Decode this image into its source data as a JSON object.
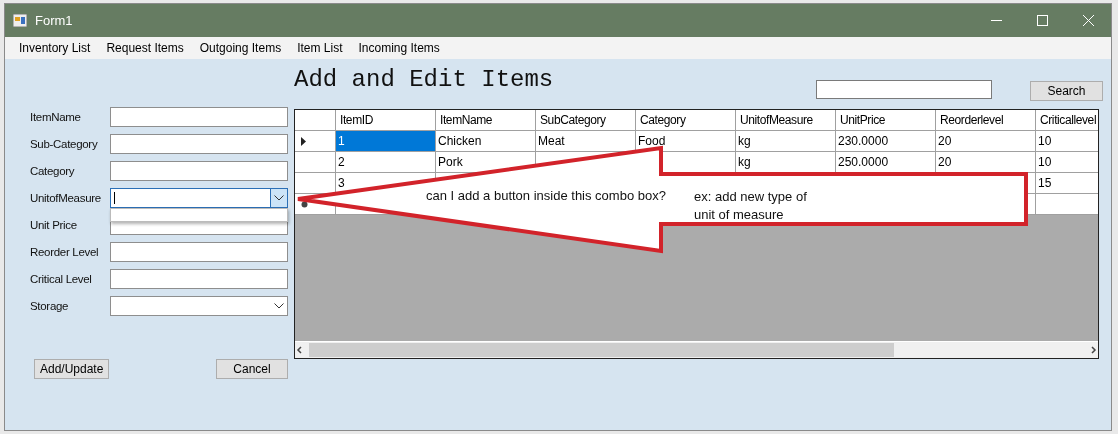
{
  "window": {
    "title": "Form1"
  },
  "menu": [
    "Inventory List",
    "Request Items",
    "Outgoing Items",
    "Item List",
    "Incoming Items"
  ],
  "heading": "Add and Edit Items",
  "form": {
    "fields": [
      {
        "label": "ItemName",
        "kind": "text",
        "focused": false
      },
      {
        "label": "Sub-Category",
        "kind": "text",
        "focused": false
      },
      {
        "label": "Category",
        "kind": "text",
        "focused": false
      },
      {
        "label": "UnitofMeasure",
        "kind": "combo",
        "focused": true,
        "open": true
      },
      {
        "label": "Unit Price",
        "kind": "text",
        "focused": false
      },
      {
        "label": "Reorder Level",
        "kind": "text",
        "focused": false
      },
      {
        "label": "Critical Level",
        "kind": "text",
        "focused": false
      },
      {
        "label": "Storage",
        "kind": "combo",
        "focused": false,
        "open": false
      }
    ],
    "buttons": [
      "Add/Update",
      "Cancel"
    ]
  },
  "search": {
    "button": "Search"
  },
  "grid": {
    "columns": [
      "ItemID",
      "ItemName",
      "SubCategory",
      "Category",
      "UnitofMeasure",
      "UnitPrice",
      "Reorderlevel",
      "Criticallevel"
    ],
    "rows": [
      {
        "kind": "data",
        "selected": true,
        "cells": [
          "1",
          "Chicken",
          "Meat",
          "Food",
          "kg",
          "230.0000",
          "20",
          "10"
        ]
      },
      {
        "kind": "data",
        "selected": false,
        "cells": [
          "2",
          "Pork",
          null,
          null,
          "kg",
          "250.0000",
          "20",
          "10"
        ]
      },
      {
        "kind": "data",
        "selected": false,
        "cells": [
          "3",
          null,
          null,
          null,
          null,
          null,
          null,
          "15"
        ]
      },
      {
        "kind": "new",
        "selected": false,
        "cells": [
          null,
          null,
          null,
          null,
          null,
          null,
          null,
          null
        ]
      }
    ]
  },
  "callout": {
    "question": "can I add a button inside this combo box?",
    "example": "ex: add new type of unit of measure"
  }
}
